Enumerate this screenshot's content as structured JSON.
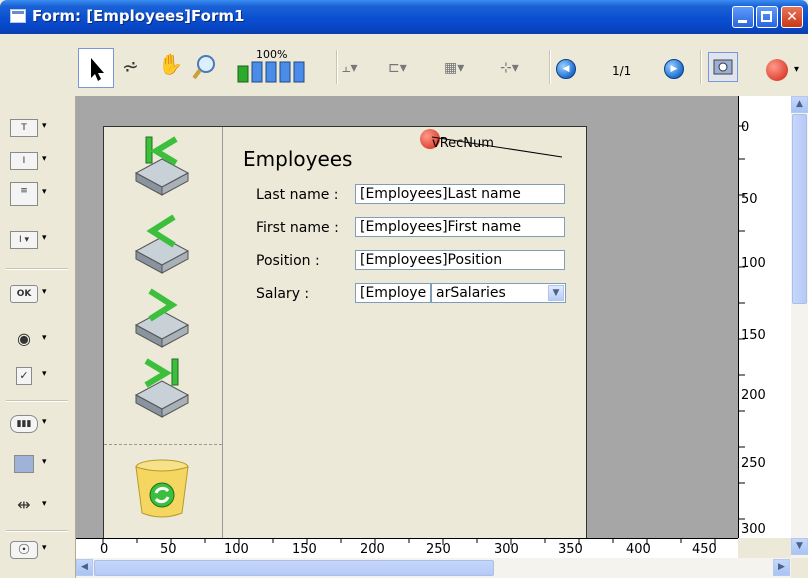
{
  "window": {
    "title": "Form: [Employees]Form1"
  },
  "toolbar": {
    "zoom_label": "100%",
    "page_indicator": "1/1"
  },
  "form": {
    "title": "Employees",
    "object_label": "vRecNum",
    "fields": [
      {
        "label": "Last name :",
        "value": "[Employees]Last name"
      },
      {
        "label": "First name :",
        "value": "[Employees]First name"
      },
      {
        "label": "Position :",
        "value": "[Employees]Position"
      },
      {
        "label": "Salary :",
        "value": "[Employe"
      }
    ],
    "salary_dropdown": "arSalaries"
  },
  "rulers": {
    "horizontal": [
      "0",
      "50",
      "100",
      "150",
      "200",
      "250",
      "300",
      "350",
      "400",
      "450"
    ],
    "vertical": [
      "0",
      "50",
      "100",
      "150",
      "200",
      "250",
      "300"
    ]
  },
  "palette": {
    "items": [
      "text-tool",
      "field-tool",
      "list-tool",
      "combo-tool",
      "button-tool",
      "radio-tool",
      "checkbox-tool",
      "progress-tool",
      "rectangle-tool",
      "splitter-tool",
      "plugin-tool"
    ],
    "ok_label": "OK"
  },
  "colors": {
    "titlebar": "#0A4FD0",
    "canvas": "#A6A6A6",
    "form_bg": "#ECE9D8"
  }
}
